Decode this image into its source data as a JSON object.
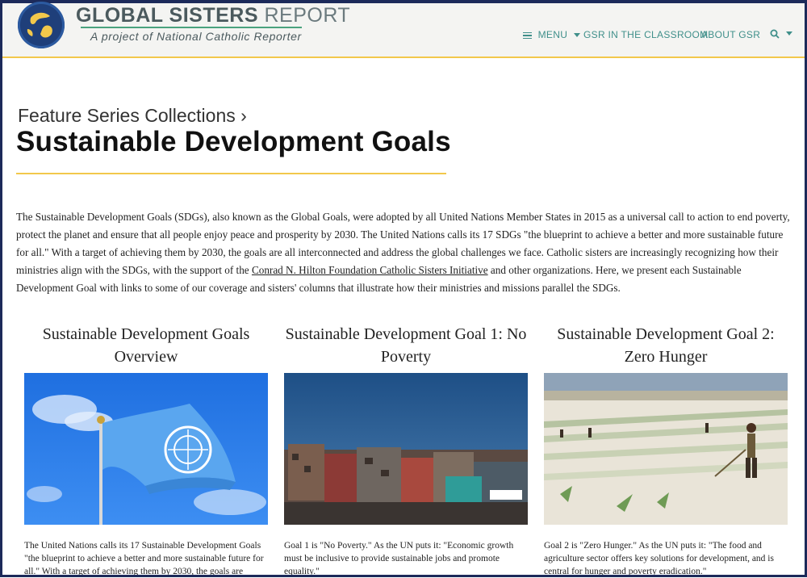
{
  "header": {
    "brand_bold": "GLOBAL SISTERS",
    "brand_light": "REPORT",
    "tagline": "A project of National Catholic Reporter",
    "nav": {
      "menu": "MENU",
      "classroom": "GSR IN THE CLASSROOM",
      "about": "ABOUT GSR"
    }
  },
  "page": {
    "breadcrumb": "Feature Series Collections ›",
    "title": "Sustainable Development Goals",
    "intro_part1": "The Sustainable Development Goals (SDGs), also known as the Global Goals, were adopted by all United Nations Member States in 2015 as a universal call to action to end poverty, protect the planet and ensure that all people enjoy peace and prosperity by 2030. The United Nations calls its 17 SDGs \"the blueprint to achieve a better and more sustainable future for all.\" With a target of achieving them by 2030, the goals are all interconnected and address the global challenges we face. Catholic sisters are increasingly recognizing how their ministries align with the SDGs, with the support of the ",
    "intro_link": "Conrad N. Hilton Foundation Catholic Sisters Initiative",
    "intro_part2": " and other organizations. Here, we present each Sustainable Development Goal with links to some of our coverage and sisters' columns that illustrate how their ministries and missions parallel the SDGs."
  },
  "cards": [
    {
      "title": "Sustainable Development Goals Overview",
      "text": "The United Nations calls its 17 Sustainable Development Goals \"the blueprint to achieve a better and more sustainable future for all.\" With a target of achieving them by 2030, the goals are"
    },
    {
      "title": "Sustainable Development Goal 1: No Poverty",
      "text": "Goal 1 is \"No Poverty.\" As the UN puts it: \"Economic growth must be inclusive to provide sustainable jobs and promote equality.\""
    },
    {
      "title": "Sustainable Development Goal 2: Zero Hunger",
      "text": "Goal 2 is \"Zero Hunger.\" As the UN puts it: \"The food and agriculture sector offers key solutions for development, and is central for hunger and poverty eradication.\""
    }
  ],
  "colors": {
    "navy": "#1c2a5a",
    "accent_yellow": "#f2c84b",
    "nav_teal": "#3f8f8a"
  },
  "icons": [
    "globe-logo-icon",
    "hamburger-icon",
    "chevron-down-icon",
    "search-icon"
  ]
}
